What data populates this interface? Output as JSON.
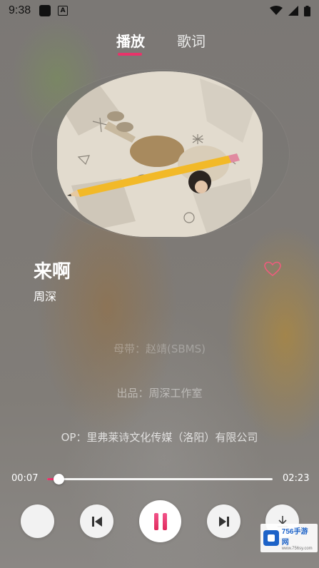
{
  "status_bar": {
    "time": "9:38",
    "indicator_a": "A",
    "icons": [
      "app-square-icon",
      "font-a-icon",
      "wifi-icon",
      "cell-signal-icon",
      "battery-icon"
    ]
  },
  "tabs": {
    "play": "播放",
    "lyrics": "歌词",
    "active": "play",
    "accent_color": "#e8336a"
  },
  "song": {
    "title": "来啊",
    "artist": "周深",
    "favorited": false
  },
  "credits": [
    "母带：赵靖(SBMS)",
    "出品：周深工作室",
    "OP：里弗莱诗文化传媒（洛阳）有限公司"
  ],
  "progress": {
    "current": "00:07",
    "total": "02:23",
    "fraction": 0.05
  },
  "controls": {
    "mode_icon": "play-mode-icon",
    "prev_icon": "skip-previous-icon",
    "play_icon": "pause-icon",
    "next_icon": "skip-next-icon",
    "download_icon": "download-icon"
  },
  "watermark": {
    "main": "756手游网",
    "sub": "www.756sy.com"
  }
}
